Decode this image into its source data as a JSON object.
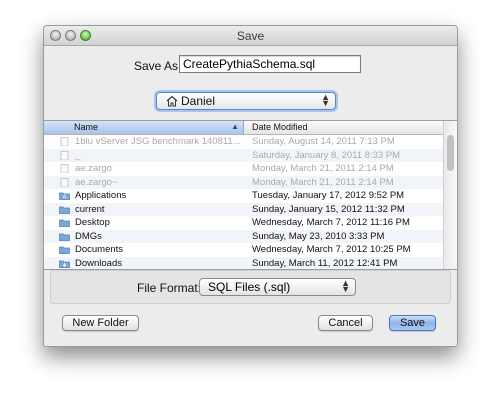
{
  "window": {
    "title": "Save"
  },
  "save_as": {
    "label": "Save As:",
    "value": "CreatePythiaSchema.sql"
  },
  "location": {
    "label": "Daniel",
    "icon": "home-icon"
  },
  "browser": {
    "columns": {
      "name": "Name",
      "date_modified": "Date Modified",
      "sort": "ascending"
    },
    "rows": [
      {
        "name": "1blu vServer JSG benchmark 140811...",
        "date": "Sunday, August 14, 2011 7:13 PM",
        "icon": "file-icon",
        "enabled": false
      },
      {
        "name": "_",
        "date": "Saturday, January 8, 2011 8:33 PM",
        "icon": "file-icon",
        "enabled": false
      },
      {
        "name": "ae.zargo",
        "date": "Monday, March 21, 2011 2:14 PM",
        "icon": "file-icon",
        "enabled": false
      },
      {
        "name": "ae.zargo~",
        "date": "Monday, March 21, 2011 2:14 PM",
        "icon": "file-icon",
        "enabled": false
      },
      {
        "name": "Applications",
        "date": "Tuesday, January 17, 2012 9:52 PM",
        "icon": "applications-folder-icon",
        "enabled": true
      },
      {
        "name": "current",
        "date": "Sunday, January 15, 2012 11:32 PM",
        "icon": "folder-icon",
        "enabled": true
      },
      {
        "name": "Desktop",
        "date": "Wednesday, March 7, 2012 11:16 PM",
        "icon": "folder-icon",
        "enabled": true
      },
      {
        "name": "DMGs",
        "date": "Sunday, May 23, 2010 3:33 PM",
        "icon": "folder-icon",
        "enabled": true
      },
      {
        "name": "Documents",
        "date": "Wednesday, March 7, 2012 10:25 PM",
        "icon": "folder-icon",
        "enabled": true
      },
      {
        "name": "Downloads",
        "date": "Sunday, March 11, 2012 12:41 PM",
        "icon": "downloads-folder-icon",
        "enabled": true
      }
    ]
  },
  "file_format": {
    "label": "File Format:",
    "selected": "SQL  Files (.sql)"
  },
  "buttons": {
    "new_folder": "New Folder",
    "cancel": "Cancel",
    "save": "Save"
  },
  "colors": {
    "accent": "#5b83c7",
    "default_button": "#8fb5ea",
    "disabled_text": "#a9a9a9"
  }
}
